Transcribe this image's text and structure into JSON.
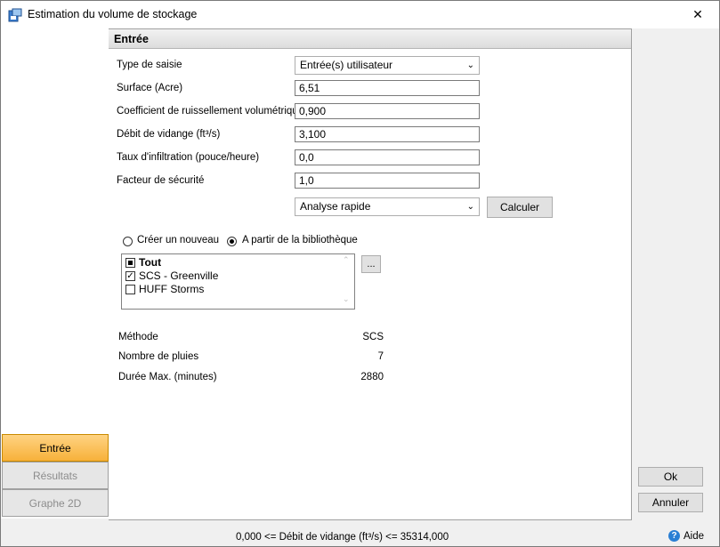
{
  "window": {
    "title": "Estimation du volume de stockage"
  },
  "section": {
    "title": "Entrée"
  },
  "form": {
    "input_type": {
      "label": "Type de saisie",
      "value": "Entrée(s) utilisateur"
    },
    "surface": {
      "label": "Surface (Acre)",
      "value": "6,51"
    },
    "runoff_coef": {
      "label": "Coefficient de ruissellement volumétrique",
      "value": "0,900"
    },
    "discharge": {
      "label": "Débit de vidange (ft³/s)",
      "value": "3,100"
    },
    "infiltration": {
      "label": "Taux d'infiltration (pouce/heure)",
      "value": "0,0"
    },
    "safety": {
      "label": "Facteur de sécurité",
      "value": "1,0"
    },
    "analysis": {
      "value": "Analyse rapide"
    },
    "compute_label": "Calculer"
  },
  "source": {
    "new_label": "Créer un nouveau",
    "library_label": "A partir de la bibliothèque",
    "selected": "library",
    "browse_label": "...",
    "items": [
      {
        "label": "Tout",
        "state": "partial",
        "bold": true
      },
      {
        "label": "SCS - Greenville",
        "state": "checked",
        "bold": false
      },
      {
        "label": "HUFF Storms",
        "state": "unchecked",
        "bold": false
      }
    ]
  },
  "info": {
    "method_label": "Méthode",
    "method_value": "SCS",
    "rains_label": "Nombre de pluies",
    "rains_value": "7",
    "duration_label": "Durée Max. (minutes)",
    "duration_value": "2880"
  },
  "nav": {
    "input_label": "Entrée",
    "results_label": "Résultats",
    "graph_label": "Graphe 2D",
    "active": "input"
  },
  "buttons": {
    "ok_label": "Ok",
    "cancel_label": "Annuler"
  },
  "status": {
    "range_text": "0,000 <= Débit de vidange (ft³/s) <= 35314,000",
    "help_label": "Aide"
  },
  "colors": {
    "nav_active": "#f7b13a",
    "help_icon": "#2a7fd4"
  },
  "icons": [
    "app-icon",
    "close-icon",
    "dropdown-arrow-icon",
    "help-icon"
  ]
}
